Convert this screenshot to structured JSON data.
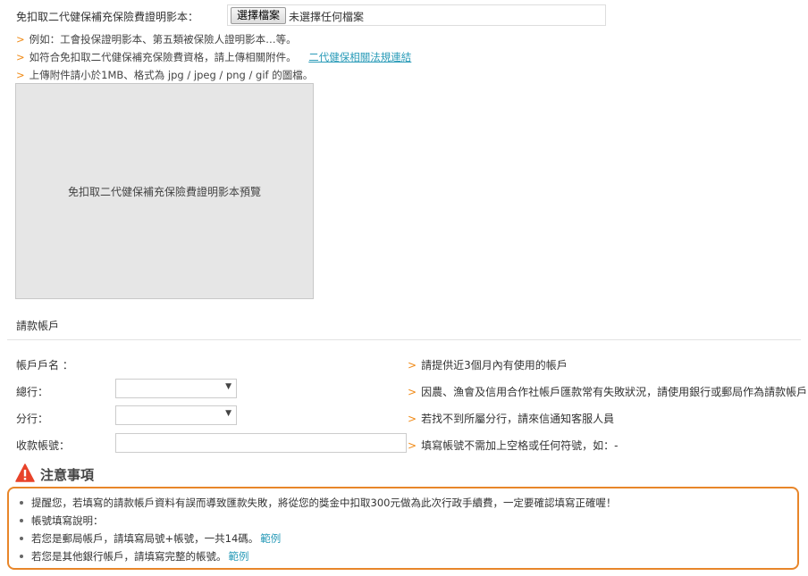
{
  "upload": {
    "label": "免扣取二代健保補充保險費證明影本：",
    "button_label": "選擇檔案",
    "status": "未選擇任何檔案"
  },
  "hints": [
    {
      "text": "例如：工會投保證明影本、第五類被保險人證明影本…等。"
    },
    {
      "text": "如符合免扣取二代健保補充保險費資格，請上傳相關附件。",
      "link": "二代健保相關法規連結"
    },
    {
      "text": "上傳附件請小於1MB、格式為 jpg / jpeg / png / gif 的圖檔。"
    }
  ],
  "preview": {
    "text": "免扣取二代健保補充保險費證明影本預覽"
  },
  "account": {
    "title": "請款帳戶",
    "rows": [
      {
        "label": "帳戶戶名 ：",
        "hint": "請提供近3個月內有使用的帳戶"
      },
      {
        "label": "總行：",
        "hint": "因農、漁會及信用合作社帳戶匯款常有失敗狀況，請使用銀行或郵局作為請款帳戶"
      },
      {
        "label": "分行：",
        "hint": "若找不到所屬分行，請來信通知客服人員"
      },
      {
        "label": "收款帳號：",
        "hint": "填寫帳號不需加上空格或任何符號，如：-"
      }
    ]
  },
  "notice": {
    "title": "注意事項",
    "items": [
      {
        "text": "提醒您，若填寫的請款帳戶資料有誤而導致匯款失敗，將從您的獎金中扣取300元做為此次行政手續費，一定要確認填寫正確喔！"
      },
      {
        "text": "帳號填寫說明："
      },
      {
        "text": "若您是郵局帳戶，請填寫局號+帳號，一共14碼。",
        "link": "範例"
      },
      {
        "text": "若您是其他銀行帳戶，請填寫完整的帳號。",
        "link": "範例"
      }
    ]
  },
  "colors": {
    "accent": "#f08a16",
    "link": "#2a9bb8",
    "notice_border": "#e8862a",
    "warning_icon": "#e8432a"
  },
  "icons": {
    "warning": "warning-icon",
    "caret": "chevron-down-icon"
  }
}
